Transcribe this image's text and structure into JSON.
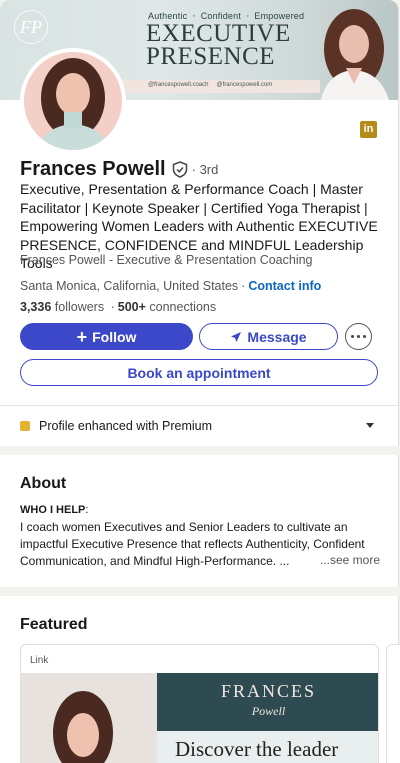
{
  "banner": {
    "monogram": "FP",
    "tagline": [
      "Authentic",
      "Confident",
      "Empowered"
    ],
    "title_line1": "EXECUTIVE",
    "title_line2": "PRESENCE",
    "handles": [
      "@francespowell.coach",
      "@francespowell.com"
    ]
  },
  "profile": {
    "name": "Frances Powell",
    "degree": "· 3rd",
    "headline": "Executive, Presentation & Performance Coach | Master Facilitator | Keynote Speaker | Certified Yoga Therapist | Empowering Women Leaders with Authentic EXECUTIVE PRESENCE, CONFIDENCE and MINDFUL Leadership Tools",
    "company": "Frances Powell - Executive & Presentation Coaching",
    "location": "Santa Monica, California, United States",
    "location_sep": "·",
    "contact_info": "Contact info",
    "followers_count": "3,336",
    "followers_label": "followers",
    "network_sep": "·",
    "connections_count": "500+",
    "connections_label": "connections"
  },
  "actions": {
    "follow": "Follow",
    "message": "Message",
    "book": "Book an appointment"
  },
  "premium": {
    "label": "Profile enhanced with Premium"
  },
  "about": {
    "title": "About",
    "label": "WHO I HELP",
    "label_suffix": ":",
    "text": "I coach women Executives and Senior Leaders to cultivate an impactful Executive Presence that reflects Authenticity, Confident Communication, and Mindful High-Performance. ...",
    "see_more": "...see more"
  },
  "featured": {
    "title": "Featured",
    "card_type": "Link",
    "brand": "FRANCES",
    "brand_script": "Powell",
    "headline": "Discover the leader"
  },
  "colors": {
    "primary_blue": "#3b48c9",
    "link_blue": "#0a66c2",
    "premium_gold": "#e2b231",
    "linkedin_badge": "#b58a18"
  }
}
